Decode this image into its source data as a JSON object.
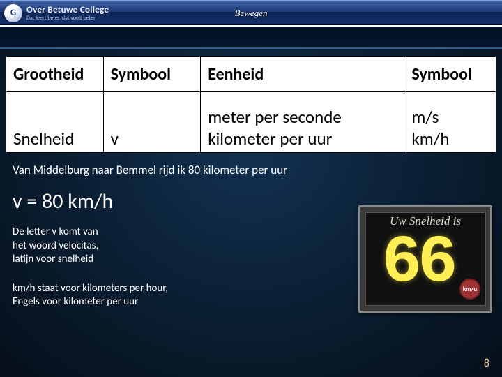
{
  "header": {
    "logo_letter": "G",
    "school_name": "Over Betuwe College",
    "tagline": "Dat leert beter, dat voelt beter",
    "page_title": "Bewegen"
  },
  "table": {
    "headers": [
      "Grootheid",
      "Symbool",
      "Eenheid",
      "Symbool"
    ],
    "row": {
      "grootheid": "Snelheid",
      "symbool": "v",
      "eenheid_line1": "meter per seconde",
      "eenheid_line2": "kilometer per uur",
      "symbool2_line1": "m/s",
      "symbool2_line2": "km/h"
    }
  },
  "sentence": "Van Middelburg naar Bemmel rijd ik 80 kilometer per uur",
  "equation": "v = 80 km/h",
  "note1_line1": "De letter v komt van",
  "note1_line2": "het woord velocitas,",
  "note1_line3": "latijn voor snelheid",
  "note2_line1": "km/h staat voor kilometers per hour,",
  "note2_line2": "Engels voor kilometer per uur",
  "sign": {
    "label": "Uw Snelheid is",
    "value": "66",
    "unit": "km/u"
  },
  "slide_number": "8"
}
